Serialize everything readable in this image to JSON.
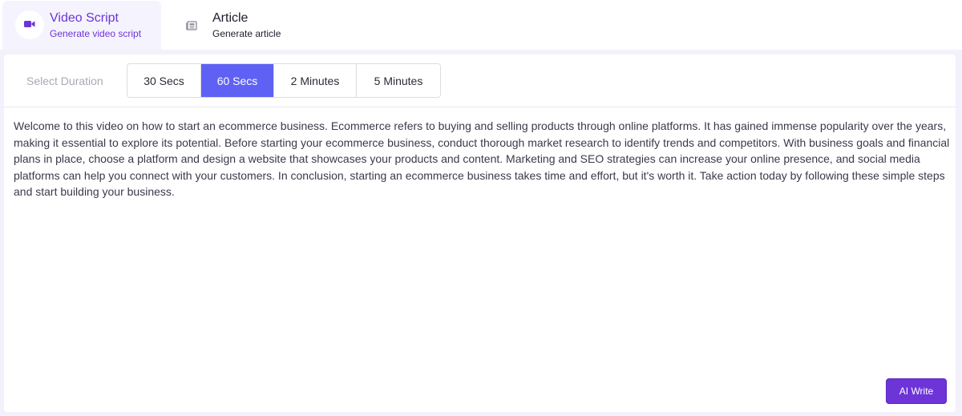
{
  "tabs": {
    "video": {
      "title": "Video Script",
      "subtitle": "Generate video script",
      "icon": "video-camera-icon",
      "active": true
    },
    "article": {
      "title": "Article",
      "subtitle": "Generate article",
      "icon": "newspaper-icon",
      "active": false
    }
  },
  "duration": {
    "label": "Select Duration",
    "options": [
      "30 Secs",
      "60 Secs",
      "2 Minutes",
      "5 Minutes"
    ],
    "selected": "60 Secs"
  },
  "content": {
    "text": "Welcome to this video on how to start an ecommerce business. Ecommerce refers to buying and selling products through online platforms. It has gained immense popularity over the years, making it essential to explore its potential. Before starting your ecommerce business, conduct thorough market research to identify trends and competitors. With business goals and financial plans in place, choose a platform and design a website that showcases your products and content. Marketing and SEO strategies can increase your online presence, and social media platforms can help you connect with your customers. In conclusion, starting an ecommerce business takes time and effort, but it's worth it. Take action today by following these simple steps and start building your business."
  },
  "actions": {
    "ai_write_label": "AI Write"
  },
  "colors": {
    "accent_purple": "#6d35d8",
    "active_segment": "#5f61f4",
    "active_tab_bg": "#f5f3fd"
  }
}
